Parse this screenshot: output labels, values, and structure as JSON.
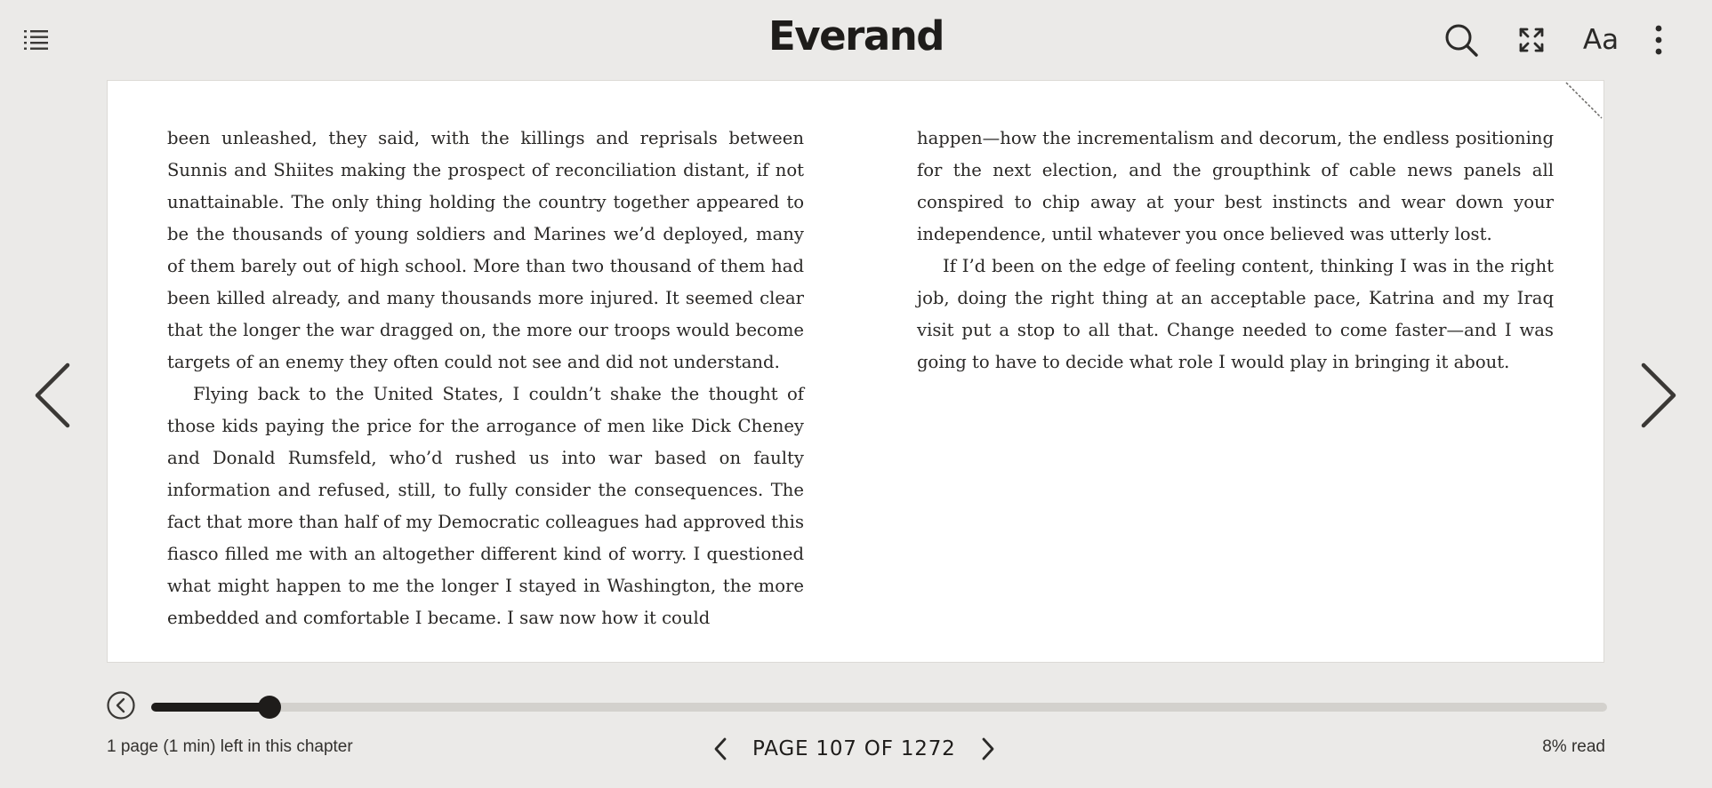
{
  "header": {
    "brand": "Everand",
    "font_button_label": "Aa"
  },
  "book": {
    "left_column": [
      "been unleashed, they said, with the killings and reprisals between Sunnis and Shiites making the prospect of reconciliation distant, if not unattainable. The only thing holding the country together appeared to be the thousands of young soldiers and Marines we’d deployed, many of them barely out of high school. More than two thousand of them had been killed already, and many thousands more injured. It seemed clear that the longer the war dragged on, the more our troops would become targets of an enemy they often could not see and did not understand.",
      "Flying back to the United States, I couldn’t shake the thought of those kids paying the price for the arrogance of men like Dick Cheney and Donald Rums­feld, who’d rushed us into war based on faulty information and refused, still, to fully consider the consequences. The fact that more than half of my Democratic colleagues had approved this fiasco filled me with an altogether different kind of worry. I questioned what might happen to me the longer I stayed in Wash­ington, the more embedded and comfortable I became. I saw now how it could"
    ],
    "right_column": [
      "happen—how the incrementalism and decorum, the endless positioning for the next election, and the groupthink of cable news panels all conspired to chip away at your best instincts and wear down your independence, until whatever you once believed was utterly lost.",
      "If I’d been on the edge of feeling content, thinking I was in the right job, doing the right thing at an acceptable pace, Katrina and my Iraq visit put a stop to all that. Change needed to come faster—and I was going to have to decide what role I would play in bringing it about."
    ]
  },
  "footer": {
    "chapter_remaining": "1 page (1 min) left in this chapter",
    "page_indicator": "PAGE 107 OF 1272",
    "percent_read": "8% read"
  },
  "progress": {
    "fraction": 0.081
  },
  "icons": {
    "toc": "list-icon",
    "search": "search-icon",
    "fullscreen": "fullscreen-icon",
    "more": "more-vertical-icon",
    "prev": "chevron-left-icon",
    "next": "chevron-right-icon",
    "back": "back-circle-icon"
  },
  "colors": {
    "background": "#ebeae8",
    "page": "#ffffff",
    "ink": "#1e1c1a",
    "track": "#d3d1cd"
  }
}
